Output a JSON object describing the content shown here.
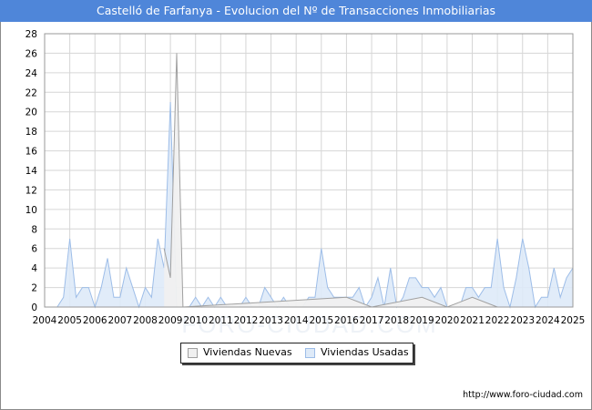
{
  "title": "Castelló de Farfanya - Evolucion del Nº de Transacciones Inmobiliarias",
  "footer": "http://www.foro-ciudad.com",
  "watermark": "FORO-CIUDAD.COM",
  "chart_data": {
    "type": "area",
    "x_labels": [
      "2004",
      "2005",
      "2006",
      "2007",
      "2008",
      "2009",
      "2010",
      "2011",
      "2012",
      "2013",
      "2014",
      "2015",
      "2016",
      "2017",
      "2018",
      "2019",
      "2020",
      "2021",
      "2022",
      "2023",
      "2024",
      "2025"
    ],
    "y_ticks": [
      0,
      2,
      4,
      6,
      8,
      10,
      12,
      14,
      16,
      18,
      20,
      22,
      24,
      26,
      28
    ],
    "ylim": [
      0,
      28
    ],
    "xlim": [
      2004,
      2025
    ],
    "grid": true,
    "legend_position": "bottom",
    "series": [
      {
        "name": "Viviendas Nuevas",
        "color": "#a0a0a0",
        "fill": "#f0f0f0",
        "points": [
          [
            2008.75,
            6
          ],
          [
            2009,
            3
          ],
          [
            2009.25,
            26
          ],
          [
            2009.5,
            0
          ],
          [
            2016,
            1
          ],
          [
            2017,
            0
          ],
          [
            2019,
            1
          ],
          [
            2020,
            0
          ],
          [
            2021,
            1
          ],
          [
            2022,
            0
          ]
        ]
      },
      {
        "name": "Viviendas Usadas",
        "color": "#9dbde8",
        "fill": "#deeaf8",
        "points": [
          [
            2004,
            0
          ],
          [
            2004.25,
            0
          ],
          [
            2004.5,
            0
          ],
          [
            2004.75,
            1
          ],
          [
            2005,
            7
          ],
          [
            2005.25,
            1
          ],
          [
            2005.5,
            2
          ],
          [
            2005.75,
            2
          ],
          [
            2006,
            0
          ],
          [
            2006.25,
            2
          ],
          [
            2006.5,
            5
          ],
          [
            2006.75,
            1
          ],
          [
            2007,
            1
          ],
          [
            2007.25,
            4
          ],
          [
            2007.5,
            2
          ],
          [
            2007.75,
            0
          ],
          [
            2008,
            2
          ],
          [
            2008.25,
            1
          ],
          [
            2008.5,
            7
          ],
          [
            2008.75,
            4
          ],
          [
            2009,
            21
          ],
          [
            2009.25,
            0
          ],
          [
            2009.5,
            0
          ],
          [
            2009.75,
            0
          ],
          [
            2010,
            1
          ],
          [
            2010.25,
            0
          ],
          [
            2010.5,
            1
          ],
          [
            2010.75,
            0
          ],
          [
            2011,
            1
          ],
          [
            2011.25,
            0
          ],
          [
            2011.5,
            0
          ],
          [
            2011.75,
            0
          ],
          [
            2012,
            1
          ],
          [
            2012.25,
            0
          ],
          [
            2012.5,
            0
          ],
          [
            2012.75,
            2
          ],
          [
            2013,
            1
          ],
          [
            2013.25,
            0
          ],
          [
            2013.5,
            1
          ],
          [
            2013.75,
            0
          ],
          [
            2014,
            0
          ],
          [
            2014.25,
            0
          ],
          [
            2014.5,
            1
          ],
          [
            2014.75,
            1
          ],
          [
            2015,
            6
          ],
          [
            2015.25,
            2
          ],
          [
            2015.5,
            1
          ],
          [
            2015.75,
            1
          ],
          [
            2016,
            1
          ],
          [
            2016.25,
            1
          ],
          [
            2016.5,
            2
          ],
          [
            2016.75,
            0
          ],
          [
            2017,
            1
          ],
          [
            2017.25,
            3
          ],
          [
            2017.5,
            0
          ],
          [
            2017.75,
            4
          ],
          [
            2018,
            0
          ],
          [
            2018.25,
            1
          ],
          [
            2018.5,
            3
          ],
          [
            2018.75,
            3
          ],
          [
            2019,
            2
          ],
          [
            2019.25,
            2
          ],
          [
            2019.5,
            1
          ],
          [
            2019.75,
            2
          ],
          [
            2020,
            0
          ],
          [
            2020.25,
            0
          ],
          [
            2020.5,
            0
          ],
          [
            2020.75,
            2
          ],
          [
            2021,
            2
          ],
          [
            2021.25,
            1
          ],
          [
            2021.5,
            2
          ],
          [
            2021.75,
            2
          ],
          [
            2022,
            7
          ],
          [
            2022.25,
            2
          ],
          [
            2022.5,
            0
          ],
          [
            2022.75,
            3
          ],
          [
            2023,
            7
          ],
          [
            2023.25,
            4
          ],
          [
            2023.5,
            0
          ],
          [
            2023.75,
            1
          ],
          [
            2024,
            1
          ],
          [
            2024.25,
            4
          ],
          [
            2024.5,
            1
          ],
          [
            2024.75,
            3
          ],
          [
            2025,
            4
          ]
        ]
      }
    ]
  }
}
